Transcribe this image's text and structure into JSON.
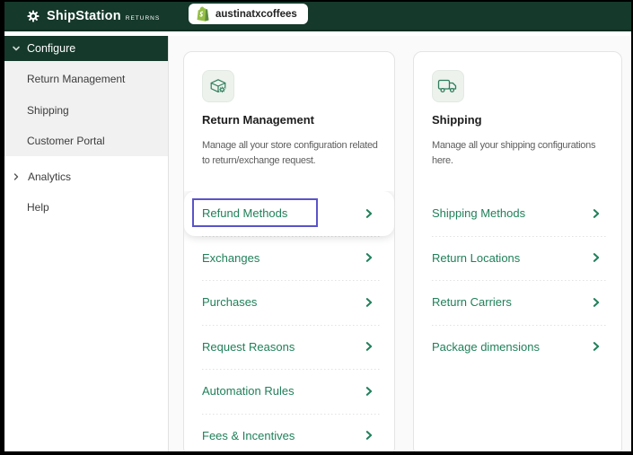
{
  "header": {
    "brand": "ShipStation",
    "brand_suffix": "RETURNS",
    "store_tab": "austinatxcoffees"
  },
  "sidebar": {
    "configure": "Configure",
    "return_management": "Return Management",
    "shipping": "Shipping",
    "customer_portal": "Customer Portal",
    "analytics": "Analytics",
    "help": "Help"
  },
  "cards": {
    "return_management": {
      "title": "Return Management",
      "description": "Manage all your store configuration related to return/exchange request.",
      "description_lines": [
        "Manage all your store configuration related",
        "to return/exchange request."
      ],
      "icon": "box-gear-icon",
      "items": [
        {
          "label": "Refund Methods",
          "highlighted": true
        },
        {
          "label": "Exchanges"
        },
        {
          "label": "Purchases"
        },
        {
          "label": "Request Reasons"
        },
        {
          "label": "Automation Rules"
        },
        {
          "label": "Fees & Incentives"
        }
      ]
    },
    "shipping": {
      "title": "Shipping",
      "description": "Manage all your shipping configurations here.",
      "description_lines": [
        "Manage all your shipping configurations",
        "here."
      ],
      "icon": "truck-icon",
      "items": [
        {
          "label": "Shipping Methods"
        },
        {
          "label": "Return Locations"
        },
        {
          "label": "Return Carriers"
        },
        {
          "label": "Package dimensions"
        }
      ]
    }
  },
  "colors": {
    "header_green": "#15392b",
    "accent_green": "#20805a",
    "highlight_purple": "#5a54c8",
    "shopify_green": "#95bf47",
    "sidebar_section_bg": "#f1f1f1"
  }
}
